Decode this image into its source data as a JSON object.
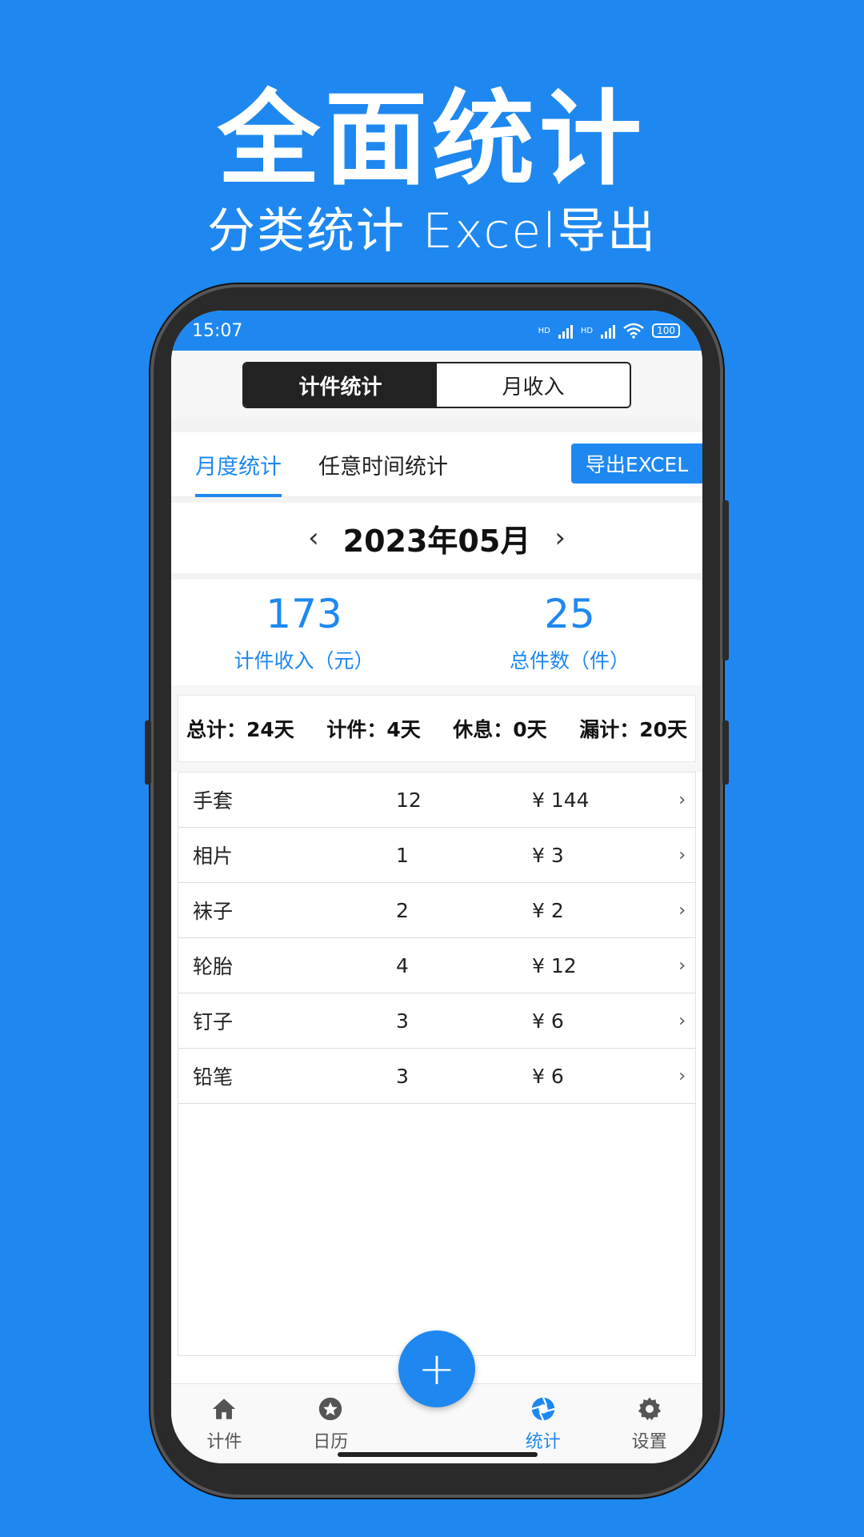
{
  "promo": {
    "headline": "全面统计",
    "subline": "分类统计 Excel导出"
  },
  "status": {
    "time": "15:07",
    "hd1": "HD",
    "hd2": "HD",
    "battery": "100"
  },
  "segment": {
    "active": "计件统计",
    "inactive": "月收入"
  },
  "tabs": {
    "monthly": "月度统计",
    "custom": "任意时间统计",
    "export": "导出EXCEL"
  },
  "month": {
    "label": "2023年05月",
    "prev": "‹",
    "next": "›"
  },
  "summary": {
    "income_value": "173",
    "income_label": "计件收入（元）",
    "count_value": "25",
    "count_label": "总件数（件）"
  },
  "stats": {
    "total": "总计：24天",
    "counted": "计件：4天",
    "rest": "休息：0天",
    "missed": "漏计：20天"
  },
  "items": [
    {
      "name": "手套",
      "qty": "12",
      "amount": "¥ 144"
    },
    {
      "name": "相片",
      "qty": "1",
      "amount": "¥ 3"
    },
    {
      "name": "袜子",
      "qty": "2",
      "amount": "¥ 2"
    },
    {
      "name": "轮胎",
      "qty": "4",
      "amount": "¥ 12"
    },
    {
      "name": "钉子",
      "qty": "3",
      "amount": "¥ 6"
    },
    {
      "name": "铅笔",
      "qty": "3",
      "amount": "¥ 6"
    }
  ],
  "nav": {
    "item1": "计件",
    "item2": "日历",
    "item3": "统计",
    "item4": "设置",
    "fab": "+"
  },
  "colors": {
    "accent": "#1e88f0",
    "dark": "#222222"
  }
}
